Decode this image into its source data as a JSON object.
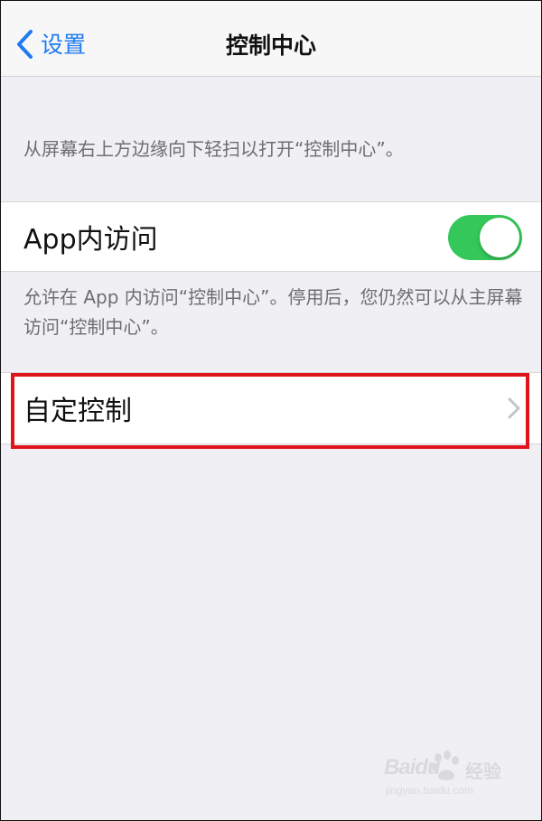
{
  "navbar": {
    "back_label": "设置",
    "title": "控制中心"
  },
  "intro_text": "从屏幕右上方边缘向下轻扫以打开“控制中心”。",
  "in_app_access": {
    "label": "App内访问",
    "enabled": true,
    "toggle_color": "#34c759"
  },
  "in_app_footer": "允许在 App 内访问“控制中心”。停用后，您仍然可以从主屏幕访问“控制中心”。",
  "customize_controls": {
    "label": "自定控制"
  },
  "highlight_color": "#e0141b",
  "accent_color": "#1f7bf0",
  "watermark": {
    "brand": "Baidu",
    "cn": "经验",
    "url": "jingyan.baidu.com"
  }
}
